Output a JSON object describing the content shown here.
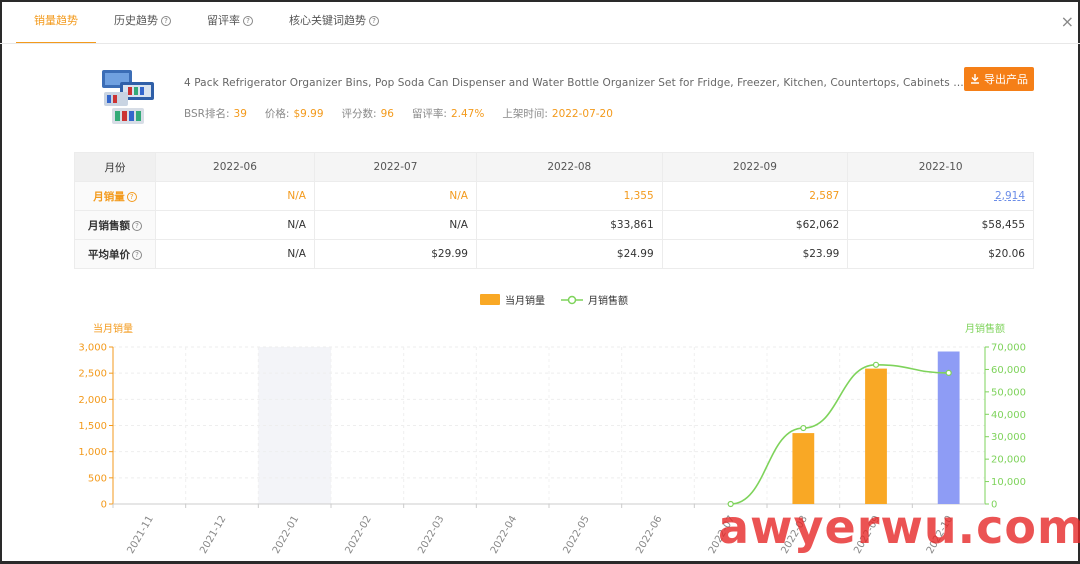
{
  "tabs": [
    {
      "label": "销量趋势",
      "help": false,
      "active": true
    },
    {
      "label": "历史趋势",
      "help": true,
      "active": false
    },
    {
      "label": "留评率",
      "help": true,
      "active": false
    },
    {
      "label": "核心关键词趋势",
      "help": true,
      "active": false
    }
  ],
  "close_icon": "×",
  "product": {
    "title": "4 Pack Refrigerator Organizer Bins, Pop Soda Can Dispenser and Water Bottle Organizer Set for Fridge, Freezer, Kitchen, Countertops, Cabinets - Clear Plastic",
    "bsr_label": "BSR排名:",
    "bsr": "39",
    "price_label": "价格:",
    "price": "$9.99",
    "reviews_label": "评分数:",
    "reviews": "96",
    "review_rate_label": "留评率:",
    "review_rate": "2.47%",
    "listed_label": "上架时间:",
    "listed": "2022-07-20"
  },
  "export_label": "导出产品",
  "table": {
    "header_label": "月份",
    "months": [
      "2022-06",
      "2022-07",
      "2022-08",
      "2022-09",
      "2022-10"
    ],
    "rows": [
      {
        "label": "月销量",
        "values": [
          "N/A",
          "N/A",
          "1,355",
          "2,587",
          "2,914"
        ]
      },
      {
        "label": "月销售额",
        "values": [
          "N/A",
          "N/A",
          "$33,861",
          "$62,062",
          "$58,455"
        ]
      },
      {
        "label": "平均单价",
        "values": [
          "N/A",
          "$29.99",
          "$24.99",
          "$23.99",
          "$20.06"
        ]
      }
    ]
  },
  "legend": {
    "bars": "当月销量",
    "line": "月销售额"
  },
  "colors": {
    "accent": "#f39a1c",
    "bar": "#f9a825",
    "bar_highlight": "#8e9cf5",
    "line": "#7ed35b",
    "left_axis": "#f39a1c",
    "right_axis": "#7ed35b"
  },
  "watermark": "awyerwu.com",
  "chart_data": {
    "type": "bar",
    "categories": [
      "2021-11",
      "2021-12",
      "2022-01",
      "2022-02",
      "2022-03",
      "2022-04",
      "2022-05",
      "2022-06",
      "2022-07",
      "2022-08",
      "2022-09",
      "2022-10"
    ],
    "ylabel": "当月销量",
    "y2label": "月销售额",
    "ylim": [
      0,
      3000
    ],
    "y2lim": [
      0,
      70000
    ],
    "yticks": [
      "0",
      "500",
      "1,000",
      "1,500",
      "2,000",
      "2,500",
      "3,000"
    ],
    "y2ticks": [
      "0",
      "10,000",
      "20,000",
      "30,000",
      "40,000",
      "50,000",
      "60,000",
      "70,000"
    ],
    "highlight_band": "2022-01",
    "series": [
      {
        "name": "当月销量",
        "type": "bar",
        "values": [
          null,
          null,
          null,
          null,
          null,
          null,
          null,
          null,
          null,
          1355,
          2587,
          2914
        ]
      },
      {
        "name": "月销售额",
        "type": "line",
        "values": [
          null,
          null,
          null,
          null,
          null,
          null,
          null,
          null,
          0,
          33861,
          62062,
          58455
        ]
      }
    ]
  }
}
